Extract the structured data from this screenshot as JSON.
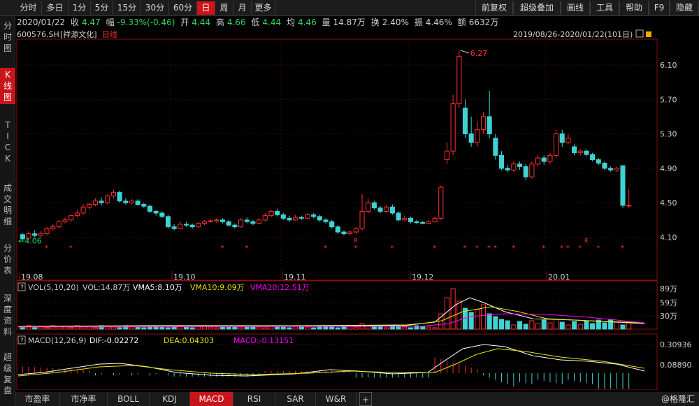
{
  "toolbar": {
    "left_items": [
      "分时",
      "多日",
      "1分",
      "5分",
      "15分",
      "30分",
      "60分",
      "日",
      "周",
      "月",
      "更多"
    ],
    "active": "日",
    "right_items": [
      "前复权",
      "超级叠加",
      "画线",
      "工具",
      "帮助",
      "F9",
      "隐藏"
    ]
  },
  "leftnav": [
    {
      "label": "分时图",
      "active": false
    },
    {
      "label": "K线图",
      "active": true
    },
    {
      "label": "TICK",
      "active": false
    },
    {
      "label": "成交明细",
      "active": false
    },
    {
      "label": "分价表",
      "active": false
    },
    {
      "label": "深度资料",
      "active": false
    },
    {
      "label": "超级复盘",
      "active": false
    }
  ],
  "info": {
    "date": "2020/01/22",
    "close_label": "收",
    "close": "4.47",
    "change_label": "幅",
    "change": "-9.33%(-0.46)",
    "open_label": "开",
    "open": "4.44",
    "high_label": "高",
    "high": "4.66",
    "low_label": "低",
    "low": "4.44",
    "avg_label": "均",
    "avg": "4.46",
    "vol_label": "量",
    "vol": "14.87万",
    "turnover_label": "换",
    "turnover": "2.40%",
    "amplitude_label": "振",
    "amplitude": "4.46%",
    "amount_label": "额",
    "amount": "6632万"
  },
  "chart_header": {
    "code": "600576.SH",
    "name": "[祥源文化]",
    "period": "日线",
    "range": "2019/08/26-2020/01/22(101日)"
  },
  "price_axis": [
    "6.10",
    "5.70",
    "5.30",
    "4.90",
    "4.50",
    "4.10"
  ],
  "date_axis": [
    "19.08",
    "19.10",
    "19.11",
    "19.12",
    "20.01"
  ],
  "annotations": {
    "high_label": "6.27",
    "low_label": "4.06"
  },
  "vol_panel": {
    "title": "VOL(5,10,20)",
    "vol": "VOL:14.87万",
    "vma5": "VMA5:8.10万",
    "vma10": "VMA10:9.09万",
    "vma20": "VMA20:12.51万",
    "axis": [
      "89万",
      "59万",
      "30万"
    ]
  },
  "macd_panel": {
    "title": "MACD(12,26,9)",
    "dif": "DIF:-0.02272",
    "dea": "DEA:0.04303",
    "macd": "MACD:-0.13151",
    "axis": [
      "0.30936",
      "0.08890"
    ]
  },
  "bottom_tabs": [
    "市盈率",
    "市净率",
    "BOLL",
    "KDJ",
    "MACD",
    "RSI",
    "SAR",
    "W&R"
  ],
  "bottom_active": "MACD",
  "watermark": "@格隆汇",
  "colors": {
    "up": "#ff3030",
    "down": "#3fd2d2",
    "dif": "#ffffff",
    "dea": "#e6e600",
    "vma20": "#ff00ff",
    "accent": "#c8151c"
  },
  "chart_data": {
    "type": "candlestick",
    "y_axis_ticks": [
      6.1,
      5.7,
      5.3,
      4.9,
      4.5,
      4.1
    ],
    "x_axis_ticks": [
      "19.08",
      "19.10",
      "19.11",
      "19.12",
      "20.01"
    ],
    "candles": [
      [
        4.13,
        4.08,
        4.15,
        4.06
      ],
      [
        4.09,
        4.14,
        4.17,
        4.07
      ],
      [
        4.14,
        4.12,
        4.18,
        4.1
      ],
      [
        4.12,
        4.14,
        4.17,
        4.1
      ],
      [
        4.14,
        4.2,
        4.22,
        4.12
      ],
      [
        4.2,
        4.22,
        4.25,
        4.18
      ],
      [
        4.22,
        4.28,
        4.3,
        4.2
      ],
      [
        4.28,
        4.3,
        4.33,
        4.26
      ],
      [
        4.3,
        4.35,
        4.36,
        4.28
      ],
      [
        4.35,
        4.38,
        4.42,
        4.33
      ],
      [
        4.38,
        4.45,
        4.48,
        4.36
      ],
      [
        4.45,
        4.48,
        4.5,
        4.42
      ],
      [
        4.48,
        4.52,
        4.55,
        4.46
      ],
      [
        4.52,
        4.5,
        4.56,
        4.47
      ],
      [
        4.5,
        4.58,
        4.6,
        4.48
      ],
      [
        4.58,
        4.62,
        4.65,
        4.55
      ],
      [
        4.62,
        4.52,
        4.64,
        4.5
      ],
      [
        4.52,
        4.5,
        4.55,
        4.48
      ],
      [
        4.5,
        4.52,
        4.54,
        4.48
      ],
      [
        4.52,
        4.48,
        4.54,
        4.46
      ],
      [
        4.48,
        4.46,
        4.5,
        4.44
      ],
      [
        4.46,
        4.4,
        4.48,
        4.38
      ],
      [
        4.4,
        4.38,
        4.42,
        4.35
      ],
      [
        4.38,
        4.34,
        4.4,
        4.32
      ],
      [
        4.34,
        4.22,
        4.36,
        4.2
      ],
      [
        4.22,
        4.2,
        4.25,
        4.18
      ],
      [
        4.2,
        4.25,
        4.28,
        4.19
      ],
      [
        4.25,
        4.24,
        4.28,
        4.22
      ],
      [
        4.24,
        4.22,
        4.26,
        4.2
      ],
      [
        4.22,
        4.26,
        4.28,
        4.21
      ],
      [
        4.26,
        4.28,
        4.3,
        4.24
      ],
      [
        4.28,
        4.29,
        4.31,
        4.27
      ],
      [
        4.29,
        4.3,
        4.32,
        4.27
      ],
      [
        4.3,
        4.28,
        4.32,
        4.26
      ],
      [
        4.28,
        4.24,
        4.3,
        4.22
      ],
      [
        4.24,
        4.22,
        4.26,
        4.2
      ],
      [
        4.22,
        4.3,
        4.32,
        4.21
      ],
      [
        4.3,
        4.28,
        4.33,
        4.26
      ],
      [
        4.28,
        4.26,
        4.3,
        4.24
      ],
      [
        4.26,
        4.3,
        4.32,
        4.25
      ],
      [
        4.3,
        4.35,
        4.38,
        4.28
      ],
      [
        4.35,
        4.4,
        4.42,
        4.33
      ],
      [
        4.4,
        4.36,
        4.43,
        4.34
      ],
      [
        4.36,
        4.32,
        4.38,
        4.3
      ],
      [
        4.32,
        4.3,
        4.35,
        4.28
      ],
      [
        4.3,
        4.33,
        4.36,
        4.29
      ],
      [
        4.33,
        4.32,
        4.35,
        4.3
      ],
      [
        4.32,
        4.36,
        4.38,
        4.31
      ],
      [
        4.36,
        4.34,
        4.38,
        4.32
      ],
      [
        4.34,
        4.3,
        4.36,
        4.28
      ],
      [
        4.3,
        4.28,
        4.32,
        4.26
      ],
      [
        4.28,
        4.22,
        4.3,
        4.2
      ],
      [
        4.22,
        4.16,
        4.24,
        4.14
      ],
      [
        4.16,
        4.14,
        4.18,
        4.12
      ],
      [
        4.14,
        4.16,
        4.18,
        4.12
      ],
      [
        4.16,
        4.2,
        4.22,
        4.14
      ],
      [
        4.2,
        4.4,
        4.6,
        4.18
      ],
      [
        4.4,
        4.5,
        4.55,
        4.38
      ],
      [
        4.5,
        4.44,
        4.52,
        4.42
      ],
      [
        4.44,
        4.4,
        4.46,
        4.38
      ],
      [
        4.4,
        4.45,
        4.48,
        4.38
      ],
      [
        4.45,
        4.38,
        4.48,
        4.36
      ],
      [
        4.38,
        4.3,
        4.4,
        4.28
      ],
      [
        4.3,
        4.32,
        4.35,
        4.29
      ],
      [
        4.32,
        4.28,
        4.34,
        4.26
      ],
      [
        4.28,
        4.27,
        4.3,
        4.25
      ],
      [
        4.27,
        4.26,
        4.29,
        4.25
      ],
      [
        4.26,
        4.28,
        4.3,
        4.25
      ],
      [
        4.28,
        4.32,
        4.34,
        4.27
      ],
      [
        4.32,
        4.68,
        4.7,
        4.3
      ],
      [
        5.0,
        5.1,
        5.2,
        4.95
      ],
      [
        5.1,
        5.65,
        5.75,
        5.05
      ],
      [
        5.65,
        6.2,
        6.27,
        5.6
      ],
      [
        5.6,
        5.3,
        5.7,
        5.25
      ],
      [
        5.3,
        5.2,
        5.5,
        5.15
      ],
      [
        5.2,
        5.35,
        5.45,
        5.15
      ],
      [
        5.35,
        5.5,
        5.55,
        5.3
      ],
      [
        5.5,
        5.3,
        5.8,
        5.25
      ],
      [
        5.25,
        5.05,
        5.3,
        5.0
      ],
      [
        5.05,
        4.9,
        5.1,
        4.88
      ],
      [
        4.9,
        4.88,
        4.94,
        4.86
      ],
      [
        4.88,
        4.95,
        4.98,
        4.86
      ],
      [
        4.95,
        4.92,
        4.98,
        4.88
      ],
      [
        4.92,
        4.8,
        4.95,
        4.76
      ],
      [
        4.8,
        4.95,
        4.98,
        4.78
      ],
      [
        4.95,
        5.02,
        5.05,
        4.92
      ],
      [
        5.02,
        4.98,
        5.05,
        4.94
      ],
      [
        4.98,
        5.05,
        5.08,
        4.95
      ],
      [
        5.05,
        5.3,
        5.35,
        5.02
      ],
      [
        5.3,
        5.2,
        5.35,
        5.15
      ],
      [
        5.2,
        5.25,
        5.3,
        5.18
      ],
      [
        5.15,
        5.08,
        5.18,
        5.05
      ],
      [
        5.08,
        5.1,
        5.12,
        5.05
      ],
      [
        5.1,
        5.06,
        5.12,
        5.04
      ],
      [
        5.06,
        5.0,
        5.08,
        4.98
      ],
      [
        5.0,
        4.96,
        5.02,
        4.94
      ],
      [
        4.96,
        4.9,
        4.98,
        4.88
      ],
      [
        4.9,
        4.88,
        4.92,
        4.86
      ],
      [
        4.88,
        4.9,
        4.92,
        4.86
      ],
      [
        4.93,
        4.47,
        4.93,
        4.44
      ],
      [
        4.47,
        4.47,
        4.66,
        4.44
      ]
    ]
  }
}
